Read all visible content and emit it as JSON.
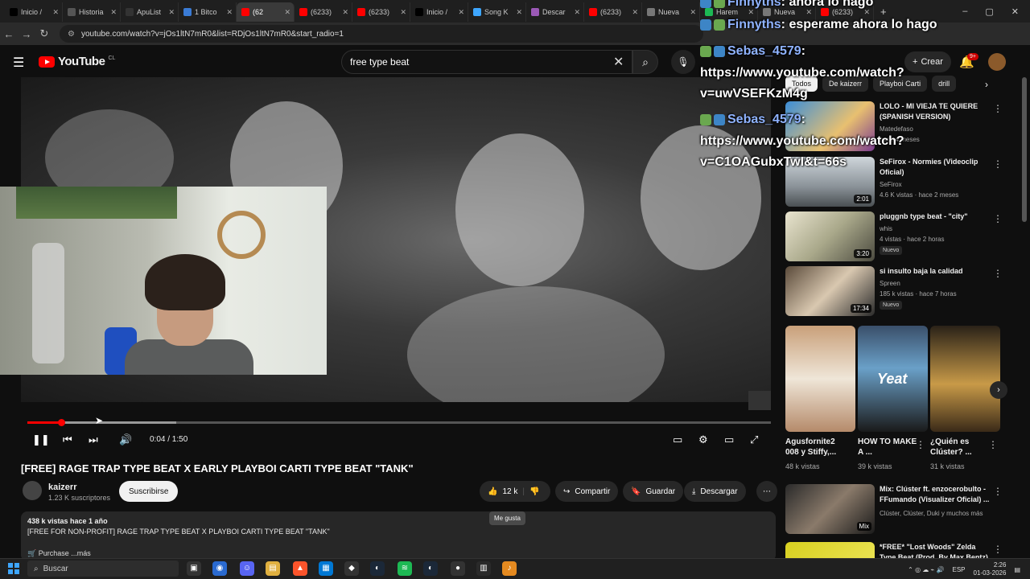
{
  "browser": {
    "tabs": [
      {
        "label": "Inicio /",
        "icon": "x-logo-icon",
        "color": "#000000"
      },
      {
        "label": "Historia",
        "icon": "book-icon",
        "color": "#555555"
      },
      {
        "label": "ApuList",
        "icon": "apu-icon",
        "color": "#333333"
      },
      {
        "label": "1 Bitco",
        "icon": "globe-icon",
        "color": "#3a7bd5"
      },
      {
        "label": "(62",
        "icon": "youtube-icon",
        "color": "#ff0000",
        "active": true
      },
      {
        "label": "(6233)",
        "icon": "youtube-icon",
        "color": "#ff0000"
      },
      {
        "label": "(6233)",
        "icon": "youtube-icon",
        "color": "#ff0000"
      },
      {
        "label": "Inicio /",
        "icon": "x-logo-icon",
        "color": "#000000"
      },
      {
        "label": "Song K",
        "icon": "song-icon",
        "color": "#3ea6ff"
      },
      {
        "label": "Descar",
        "icon": "download-icon",
        "color": "#9b59b6"
      },
      {
        "label": "(6233)",
        "icon": "youtube-icon",
        "color": "#ff0000"
      },
      {
        "label": "Nueva",
        "icon": "globe-icon",
        "color": "#777777"
      },
      {
        "label": "Harem",
        "icon": "spotify-icon",
        "color": "#1db954"
      },
      {
        "label": "Nueva",
        "icon": "globe-icon",
        "color": "#777777"
      },
      {
        "label": "(6233)",
        "icon": "youtube-icon",
        "color": "#ff0000"
      }
    ],
    "new_tab": "+",
    "url": "youtube.com/watch?v=jOs1ltN7mR0&list=RDjOs1ltN7mR0&start_radio=1",
    "window_controls": [
      "–",
      "▢",
      "✕"
    ]
  },
  "youtube": {
    "logo": "YouTube",
    "region": "CL",
    "search_value": "free type beat",
    "create_label": "Crear",
    "notif_badge": "9+"
  },
  "player": {
    "progress_fraction": 0.045,
    "buffer_fraction": 0.2,
    "time": "0:04 / 1:50"
  },
  "video": {
    "title": "[FREE] RAGE TRAP TYPE BEAT X EARLY PLAYBOI CARTI TYPE BEAT \"TANK\"",
    "channel": "kaizerr",
    "subscribers": "1.23 K suscriptores",
    "subscribe_label": "Suscribirse",
    "likes": "12 k",
    "like_tooltip": "Me gusta",
    "share_label": "Compartir",
    "save_label": "Guardar",
    "download_label": "Descargar",
    "views_date": "438 k vistas  hace 1 año",
    "description": "[FREE FOR NON-PROFIT] RAGE TRAP TYPE BEAT X PLAYBOI CARTI TYPE BEAT \"TANK\"",
    "purchase_more": "🛒 Purchase ...más"
  },
  "sidebar": {
    "chips": [
      "Todos",
      "De kaizerr",
      "Playboi Carti",
      "drill"
    ],
    "recs": [
      {
        "title": "LOLO - MI VIEJA TE QUIERE (SPANISH VERSION)",
        "channel": "Matedefaso",
        "meta": "hace 4 meses",
        "duration": "",
        "new": ""
      },
      {
        "title": "SeFirox - Normies (Videoclip Oficial)",
        "channel": "SeFirox",
        "meta": "4.6 K vistas · hace 2 meses",
        "duration": "2:01",
        "new": ""
      },
      {
        "title": "pluggnb type beat - \"city\"",
        "channel": "whis",
        "meta": "4 vistas · hace 2 horas",
        "duration": "3:20",
        "new": "Nuevo"
      },
      {
        "title": "si insulto baja la calidad",
        "channel": "Spreen",
        "meta": "185 k vistas · hace 7 horas",
        "duration": "17:34",
        "new": "Nuevo"
      }
    ],
    "shorts": [
      {
        "title": "Agusfornite2 008 y Stiffy,...",
        "views": "48 k vistas"
      },
      {
        "title": "HOW TO MAKE A ...",
        "views": "39 k vistas",
        "overlay": "Yeat"
      },
      {
        "title": "¿Quién es Clúster? ...",
        "views": "31 k vistas"
      }
    ],
    "mix": {
      "title": "Mix: Clúster ft. enzocerobulto - FFumando (Visualizer Oficial) ...",
      "channel": "Clúster, Clúster, Duki y muchos más",
      "badge": "Mix"
    },
    "last": {
      "title": "*FREE* \"Lost Woods\" Zelda Type Beat (Prod. By Max Bentz)"
    }
  },
  "chat": [
    {
      "user": "Finnyths",
      "text": ": ahora lo hago"
    },
    {
      "user": "Finnyths",
      "text": ": esperame ahora lo hago"
    },
    {
      "user": "Sebas_4579",
      "text": ":"
    },
    {
      "user": "",
      "text": "https://www.youtube.com/watch?"
    },
    {
      "user": "",
      "text": "v=uwVSEFKzM4g"
    },
    {
      "user": "Sebas_4579",
      "text": ":"
    },
    {
      "user": "",
      "text": "https://www.youtube.com/watch?"
    },
    {
      "user": "",
      "text": "v=C1OAGubxTwI&t=66s"
    }
  ],
  "taskbar": {
    "search": "Buscar",
    "lang": "ESP",
    "time": "2:26",
    "date": "01-03-2026"
  }
}
